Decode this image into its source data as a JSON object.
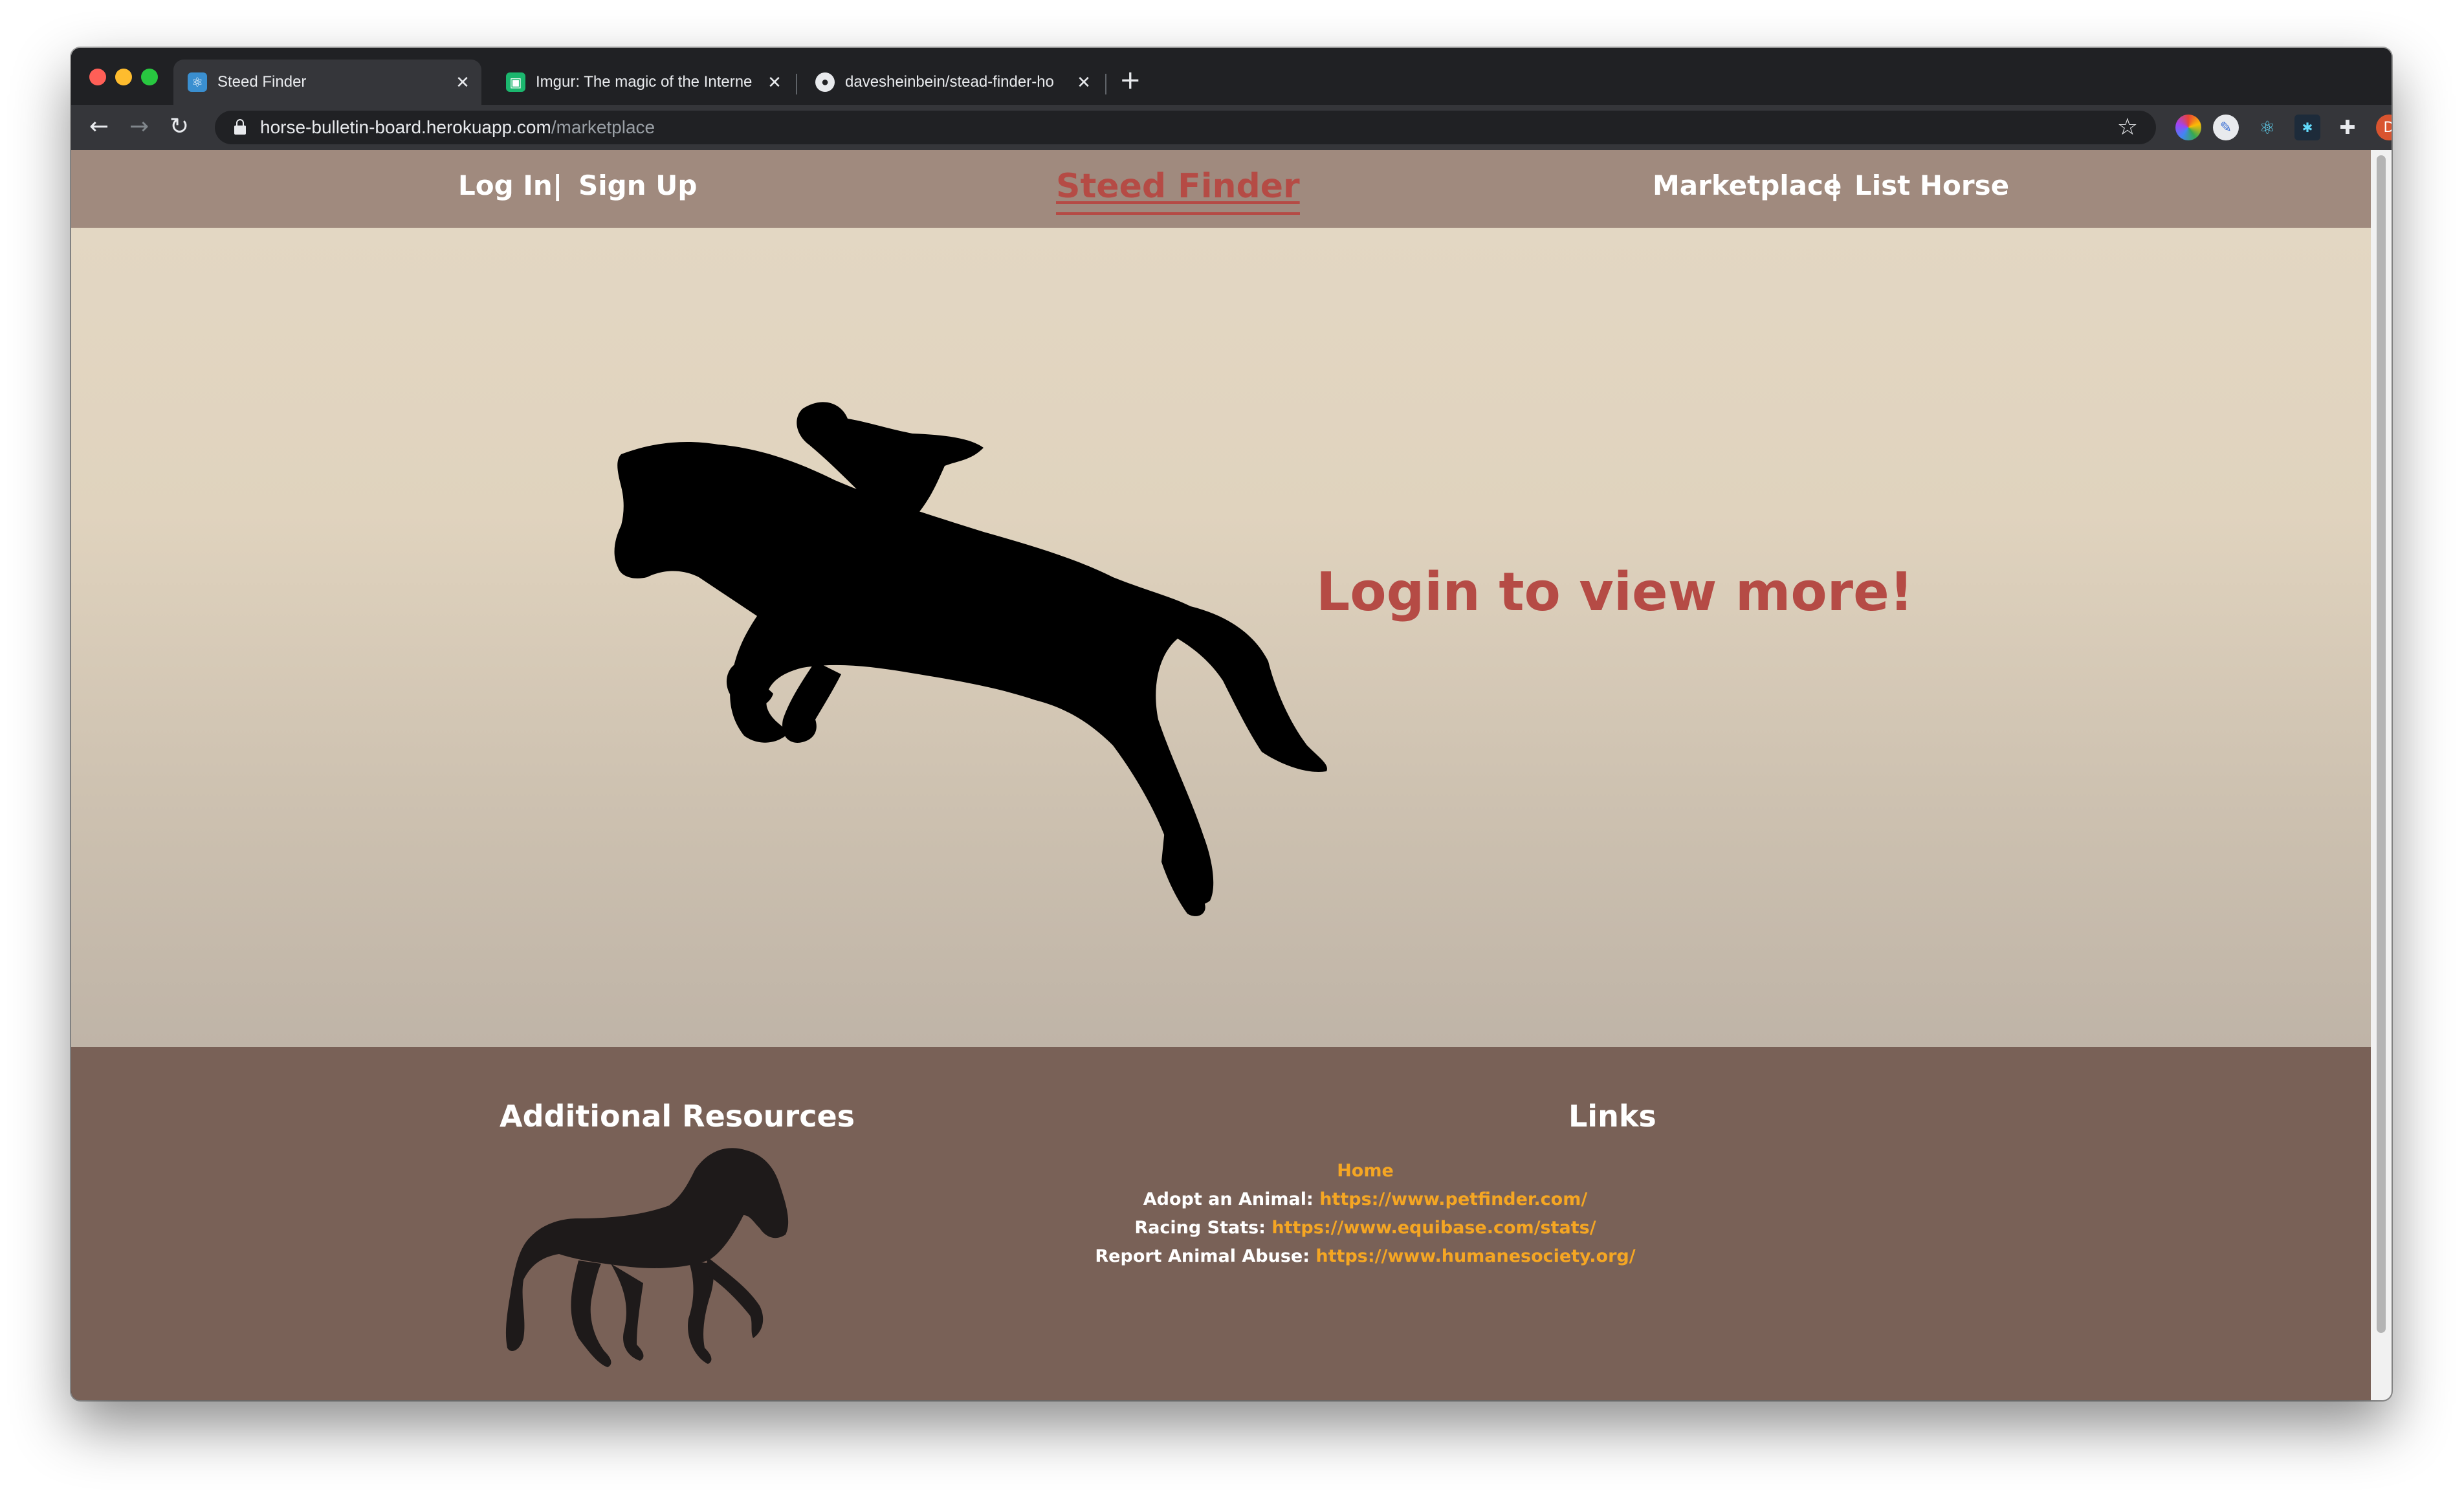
{
  "browser": {
    "tabs": [
      {
        "title": "Steed Finder",
        "active": true
      },
      {
        "title": "Imgur: The magic of the Interne",
        "active": false
      },
      {
        "title": "davesheinbein/stead-finder-ho",
        "active": false
      }
    ],
    "url_host": "horse-bulletin-board.herokuapp.com",
    "url_path": "/marketplace",
    "profile_initial": "D"
  },
  "nav": {
    "login": "Log In",
    "separator": "|",
    "signup": "Sign Up",
    "brand": "Steed Finder",
    "marketplace": "Marketplace",
    "list_horse": "List Horse"
  },
  "hero": {
    "message": "Login to view more!"
  },
  "footer": {
    "resources_heading": "Additional Resources",
    "links_heading": "Links",
    "home": "Home",
    "links": [
      {
        "label": "Adopt an Animal:",
        "url": "https://www.petfinder.com/"
      },
      {
        "label": "Racing Stats:",
        "url": "https://www.equibase.com/stats/"
      },
      {
        "label": "Report Animal Abuse:",
        "url": "https://www.humanesociety.org/"
      }
    ]
  },
  "colors": {
    "nav_bg": "#a08a7e",
    "brand_red": "#b54b45",
    "hero_top": "#e3d7c3",
    "hero_bottom": "#bfb4a7",
    "footer_bg": "#796157",
    "link_orange": "#f5a623"
  }
}
